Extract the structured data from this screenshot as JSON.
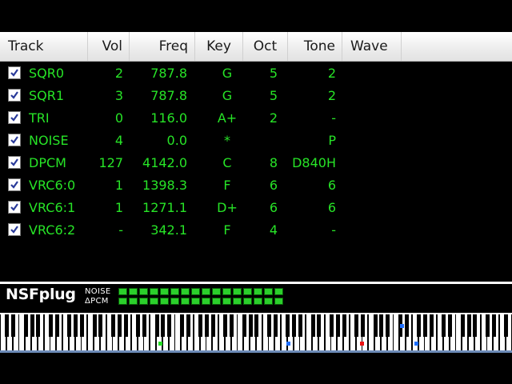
{
  "columns": [
    "Track",
    "Vol",
    "Freq",
    "Key",
    "Oct",
    "Tone",
    "Wave"
  ],
  "rows": [
    {
      "track": "SQR0",
      "vol": "2",
      "freq": "787.8",
      "key": "G",
      "oct": "5",
      "tone": "2"
    },
    {
      "track": "SQR1",
      "vol": "3",
      "freq": "787.8",
      "key": "G",
      "oct": "5",
      "tone": "2"
    },
    {
      "track": "TRI",
      "vol": "0",
      "freq": "116.0",
      "key": "A+",
      "oct": "2",
      "tone": "-"
    },
    {
      "track": "NOISE",
      "vol": "4",
      "freq": "0.0",
      "key": "*",
      "oct": "",
      "tone": "P"
    },
    {
      "track": "DPCM",
      "vol": "127",
      "freq": "4142.0",
      "key": "C",
      "oct": "8",
      "tone": "D840H"
    },
    {
      "track": "VRC6:0",
      "vol": "1",
      "freq": "1398.3",
      "key": "F",
      "oct": "6",
      "tone": "6"
    },
    {
      "track": "VRC6:1",
      "vol": "1",
      "freq": "1271.1",
      "key": "D+",
      "oct": "6",
      "tone": "6"
    },
    {
      "track": "VRC6:2",
      "vol": "-",
      "freq": "342.1",
      "key": "F",
      "oct": "4",
      "tone": "-"
    }
  ],
  "footer": {
    "logo": "NSFplug",
    "noise_label": "NOISE",
    "dpcm_label": "ΔPCM",
    "noise_level": 1.0,
    "dpcm_level": 1.0
  },
  "colors": {
    "text_green": "#27e427",
    "note_green": "#22dd22",
    "note_blue": "#1e6fff",
    "note_red": "#ee1111"
  }
}
